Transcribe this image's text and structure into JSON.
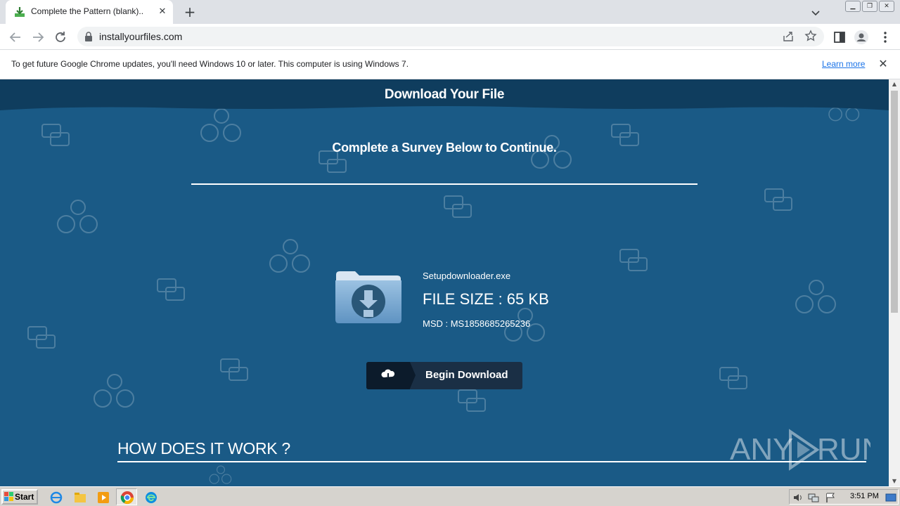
{
  "browser": {
    "tab_title": "Complete the Pattern (blank)..",
    "url": "installyourfiles.com"
  },
  "infobar": {
    "message": "To get future Google Chrome updates, you'll need Windows 10 or later. This computer is using Windows 7.",
    "learn_more": "Learn more"
  },
  "page": {
    "header_title": "Download Your File",
    "survey_text": "Complete a Survey Below to Continue.",
    "file_name": "Setupdownloader.exe",
    "file_size": "FILE SIZE : 65 KB",
    "msd": "MSD : MS1858685265236",
    "download_button": "Begin Download",
    "how_title": "HOW DOES IT WORK ?",
    "watermark": "ANY RUN"
  },
  "taskbar": {
    "start": "Start",
    "time": "3:51 PM"
  },
  "colors": {
    "page_bg": "#1a5a86",
    "header_bg": "#0f3d5e",
    "button_bg": "#1a2f45"
  }
}
